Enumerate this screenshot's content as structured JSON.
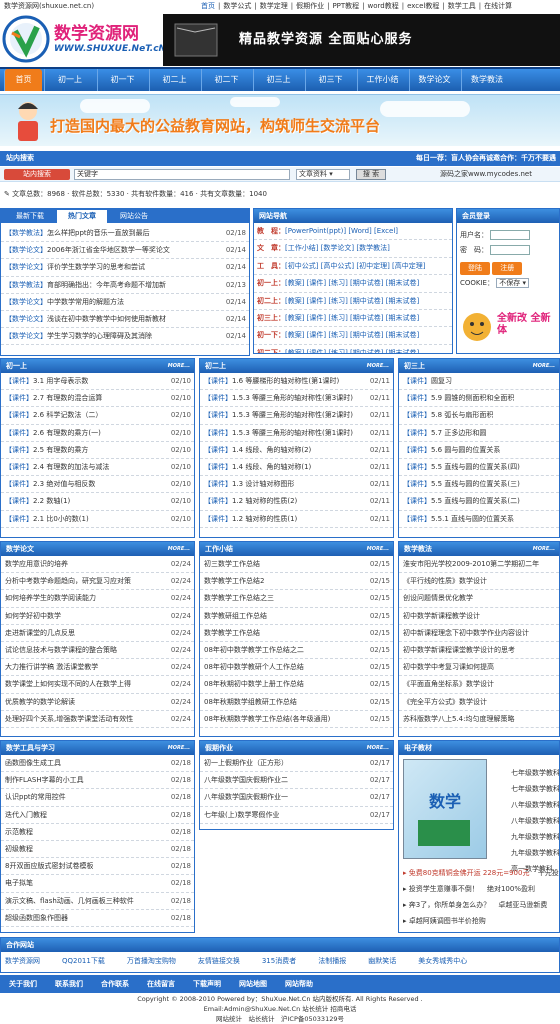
{
  "top": {
    "site": "数学资源网(shuxue.net.cn)",
    "links": [
      "首页",
      "数学公式",
      "数学定理",
      "假期作业",
      "PPT教程",
      "word教程",
      "excel教程",
      "数学工具",
      "在线计算"
    ]
  },
  "logo": {
    "cn": "数学资源网",
    "en": "WWW.SHUXUE.NeT.cN",
    "seal": "CHINA SHUXUE"
  },
  "banner": {
    "text": "精品教学资源   全面贴心服务"
  },
  "nav": [
    "首页",
    "初一上",
    "初一下",
    "初二上",
    "初二下",
    "初三上",
    "初三下",
    "工作小结",
    "数学论文",
    "数学教法"
  ],
  "hero": {
    "title": "打造国内最大的公益教育网站，构筑师生交流平台"
  },
  "search": {
    "label": "站内搜索",
    "notice": "每日一荐：盲人协会再诚邀合作：千万不要遇",
    "tag": "站内搜索",
    "placeholder": "关键字",
    "select": "文章资料",
    "button": "搜 索",
    "partner": "源码之家www.mycodes.net"
  },
  "stats": "文章总数：8968 · 软件总数：5330 · 共有软件数量：416 · 共有文章数量：1040",
  "tabs": [
    "最新下载",
    "热门文章",
    "网站公告"
  ],
  "hot": [
    {
      "c": "【数学教法】",
      "t": "怎么样把ppt的音乐一直放到最后",
      "d": "02/18"
    },
    {
      "c": "【数学论文】",
      "t": "2006年浙江省金华地区数学一等奖论文",
      "d": "02/14"
    },
    {
      "c": "【数学论文】",
      "t": "评价学生数学学习的思考和尝试",
      "d": "02/14"
    },
    {
      "c": "【数学教法】",
      "t": "育部明确指出：今年高考命题不增加新",
      "d": "02/13"
    },
    {
      "c": "【数学论文】",
      "t": "中学数学常用的解题方法",
      "d": "02/14"
    },
    {
      "c": "【数学论文】",
      "t": "浅谈在初中数学教学中如何使用新教材",
      "d": "02/14"
    },
    {
      "c": "【数学论文】",
      "t": "学生学习数学的心理障碍及其消除",
      "d": "02/14"
    }
  ],
  "guide": {
    "title": "网站导航",
    "rows": [
      {
        "k": "教　程：",
        "v": "[PowerPoint(ppt)] [Word] [Excel]"
      },
      {
        "k": "文　章：",
        "v": "[工作小结] [数学论文] [数学教法]"
      },
      {
        "k": "工　具：",
        "v": "[初中公式] [高中公式] [初中定理] [高中定理]"
      },
      {
        "k": "初一上：",
        "v": "[教案] [课件] [练习] [期中试卷] [期末试卷]"
      },
      {
        "k": "初二上：",
        "v": "[教案] [课件] [练习] [期中试卷] [期末试卷]"
      },
      {
        "k": "初三上：",
        "v": "[教案] [课件] [练习] [期中试卷] [期末试卷]"
      },
      {
        "k": "初一下：",
        "v": "[教案] [课件] [练习] [期中试卷] [期末试卷]"
      },
      {
        "k": "初二下：",
        "v": "[教案] [课件] [练习] [期中试卷] [期末试卷]"
      }
    ]
  },
  "login": {
    "title": "会员登录",
    "user": "用户名：",
    "pass": "密　码：",
    "login": "登陆",
    "reg": "注册",
    "cookie": "COOKIE：",
    "cookie_opt": "不保存",
    "promo": "全新改 全新体"
  },
  "boxes": [
    {
      "title": "初一上",
      "more": "MORE...",
      "items": [
        [
          "【课件】",
          "3.1 用字母表示数",
          "02/10"
        ],
        [
          "【课件】",
          "2.7 有理数的混合运算",
          "02/10"
        ],
        [
          "【课件】",
          "2.6 科学记数法（二）",
          "02/10"
        ],
        [
          "【课件】",
          "2.6 有理数的乘方(一)",
          "02/10"
        ],
        [
          "【课件】",
          "2.5 有理数的乘方",
          "02/10"
        ],
        [
          "【课件】",
          "2.4 有理数的加法与减法",
          "02/10"
        ],
        [
          "【课件】",
          "2.3 绝对值与相反数",
          "02/10"
        ],
        [
          "【课件】",
          "2.2 数轴(1)",
          "02/10"
        ],
        [
          "【课件】",
          "2.1 比0小的数(1)",
          "02/10"
        ]
      ]
    },
    {
      "title": "初二上",
      "more": "MORE...",
      "items": [
        [
          "【课件】",
          "1.6 等腰梯形的轴对称性(第1课时)",
          "02/11"
        ],
        [
          "【课件】",
          "1.5.3 等腰三角形的轴对称性(第3课时)",
          "02/11"
        ],
        [
          "【课件】",
          "1.5.3 等腰三角形的轴对称性(第2课时)",
          "02/11"
        ],
        [
          "【课件】",
          "1.5.3 等腰三角形的轴对称性(第1课时)",
          "02/11"
        ],
        [
          "【课件】",
          "1.4 线段、角的轴对称(2)",
          "02/11"
        ],
        [
          "【课件】",
          "1.4 线段、角的轴对称(1)",
          "02/11"
        ],
        [
          "【课件】",
          "1.3 设计轴对称图形",
          "02/11"
        ],
        [
          "【课件】",
          "1.2 轴对称的性质(2)",
          "02/11"
        ],
        [
          "【课件】",
          "1.2 轴对称的性质(1)",
          "02/11"
        ]
      ]
    },
    {
      "title": "初三上",
      "more": "MORE...",
      "items": [
        [
          "【课件】",
          "圆复习",
          ""
        ],
        [
          "【课件】",
          "5.9 圆锥的侧面积和全面积",
          ""
        ],
        [
          "【课件】",
          "5.8 弧长与扇形面积",
          ""
        ],
        [
          "【课件】",
          "5.7 正多边形和圆",
          ""
        ],
        [
          "【课件】",
          "5.6 圆与圆的位置关系",
          ""
        ],
        [
          "【课件】",
          "5.5 直线与圆的位置关系(四)",
          ""
        ],
        [
          "【课件】",
          "5.5 直线与圆的位置关系(三)",
          ""
        ],
        [
          "【课件】",
          "5.5 直线与圆的位置关系(二)",
          ""
        ],
        [
          "【课件】",
          "5.5.1 直线与圆的位置关系",
          ""
        ]
      ]
    },
    {
      "title": "数学论文",
      "more": "MORE...",
      "items": [
        [
          "",
          "数学应用意识的培养",
          "02/24"
        ],
        [
          "",
          "分析中考数学命题趋向，研究复习应对策",
          "02/24"
        ],
        [
          "",
          "如何培养学生的数学阅读能力",
          "02/24"
        ],
        [
          "",
          "如何学好初中数学",
          "02/24"
        ],
        [
          "",
          "走进新课堂的几点反思",
          "02/24"
        ],
        [
          "",
          "试论信息技术与数学课程的整合策略",
          "02/24"
        ],
        [
          "",
          "大力推行讲学稿 激活课堂教学",
          "02/24"
        ],
        [
          "",
          "数学课堂上如何实现不同的人在数学上得",
          "02/24"
        ],
        [
          "",
          "优质教学的数学论解读",
          "02/24"
        ],
        [
          "",
          "处理好四个关系,增强数学课堂活动有效性",
          "02/24"
        ]
      ]
    },
    {
      "title": "工作小结",
      "more": "MORE...",
      "items": [
        [
          "",
          "初三数学工作总结",
          "02/15"
        ],
        [
          "",
          "数学教学工作总结2",
          "02/15"
        ],
        [
          "",
          "数学教学工作总结之三",
          "02/15"
        ],
        [
          "",
          "数学教研组工作总结",
          "02/15"
        ],
        [
          "",
          "数学教学工作总结",
          "02/15"
        ],
        [
          "",
          "08年初中数学教学工作总结之二",
          "02/15"
        ],
        [
          "",
          "08年初中数学教研个人工作总结",
          "02/15"
        ],
        [
          "",
          "08年秋期初中数学上册工作总结",
          "02/15"
        ],
        [
          "",
          "08年秋期数学组教研工作总结",
          "02/15"
        ],
        [
          "",
          "08年秋期数学教学工作总结(各年级通用)",
          "02/15"
        ]
      ]
    },
    {
      "title": "数学教法",
      "more": "MORE...",
      "items": [
        [
          "",
          "淮安市阳光学校2009-2010第二学期初二年",
          ""
        ],
        [
          "",
          "《平行线的性质》数学设计",
          ""
        ],
        [
          "",
          "创设问题情景优化教学",
          ""
        ],
        [
          "",
          "初中数学新课程教学设计",
          ""
        ],
        [
          "",
          "初中新课程理念下初中数学作业内容设计",
          ""
        ],
        [
          "",
          "初中数学新课程课堂教学设计的思考",
          ""
        ],
        [
          "",
          "初中数学中考复习课如何提高",
          ""
        ],
        [
          "",
          "《平面直角坐标系》数学设计",
          ""
        ],
        [
          "",
          "《完全平方公式》数学设计",
          ""
        ],
        [
          "",
          "苏科版数学八上5.4:均匀度理解策略",
          ""
        ]
      ]
    },
    {
      "title": "数学工具与学习",
      "more": "MORE...",
      "items": [
        [
          "",
          "函数图像生成工具",
          "02/18"
        ],
        [
          "",
          "制作FLASH字幕的小工具",
          "02/18"
        ],
        [
          "",
          "认识ppt的常用控件",
          "02/18"
        ],
        [
          "",
          "迭代入门教程",
          "02/18"
        ],
        [
          "",
          "示范教程",
          "02/18"
        ],
        [
          "",
          "初级教程",
          "02/18"
        ],
        [
          "",
          "8开双面应版式密封试卷模板",
          "02/18"
        ],
        [
          "",
          "电子拟笔",
          "02/18"
        ],
        [
          "",
          "演示文稿、flash动画、几何画板三种软件",
          "02/18"
        ],
        [
          "",
          "超级函数图象作图器",
          "02/18"
        ]
      ]
    },
    {
      "title": "假期作业",
      "more": "MORE...",
      "items": [
        [
          "",
          "初一上假期作业（正方形）",
          "02/17"
        ],
        [
          "",
          "八年级数学国庆假期作业二",
          "02/17"
        ],
        [
          "",
          "八年级数学国庆假期作业一",
          "02/17"
        ],
        [
          "",
          "七年级(上)数学寒假作业",
          "02/17"
        ]
      ]
    }
  ],
  "ebook": {
    "title": "电子教材",
    "cover": "数学",
    "list": [
      "七年级数学教科",
      "七年级数学教科",
      "八年级数学教科",
      "八年级数学教科",
      "九年级数学教科",
      "九年级数学教科",
      "高一数学教科"
    ],
    "ads": [
      "免费80克精铜金佛开运 228元=900元",
      "投资学生意赚事不倒！",
      "奔3了，你所单身怎么办？",
      "卓越阿姨调图书半价抢购"
    ],
    "ads2": [
      "千元投资半年成富",
      "绝对100%盈利",
      "卓越亚马逊新费"
    ]
  },
  "partners": {
    "title": "合作网站",
    "links": [
      "数学资源网",
      "QQ2011下载",
      "万首播淘宝购物",
      "友情链接交换",
      "315消费者",
      "法制播报",
      "幽默笑话",
      "美女秀城秀中心"
    ]
  },
  "footer": [
    "关于我们",
    "联系我们",
    "合作联系",
    "在线留言",
    "下载声明",
    "网站地图",
    "网站帮助"
  ],
  "copy": [
    "Copyright © 2008-2010 Powered by：ShuXue.Net.Cn 站内版权所有. All Rights Reserved .",
    "Email:Admin@ShuXue.Net.Cn 站长统计 招商电话",
    "网站统计　站长统计　沪ICP备05033129号"
  ]
}
